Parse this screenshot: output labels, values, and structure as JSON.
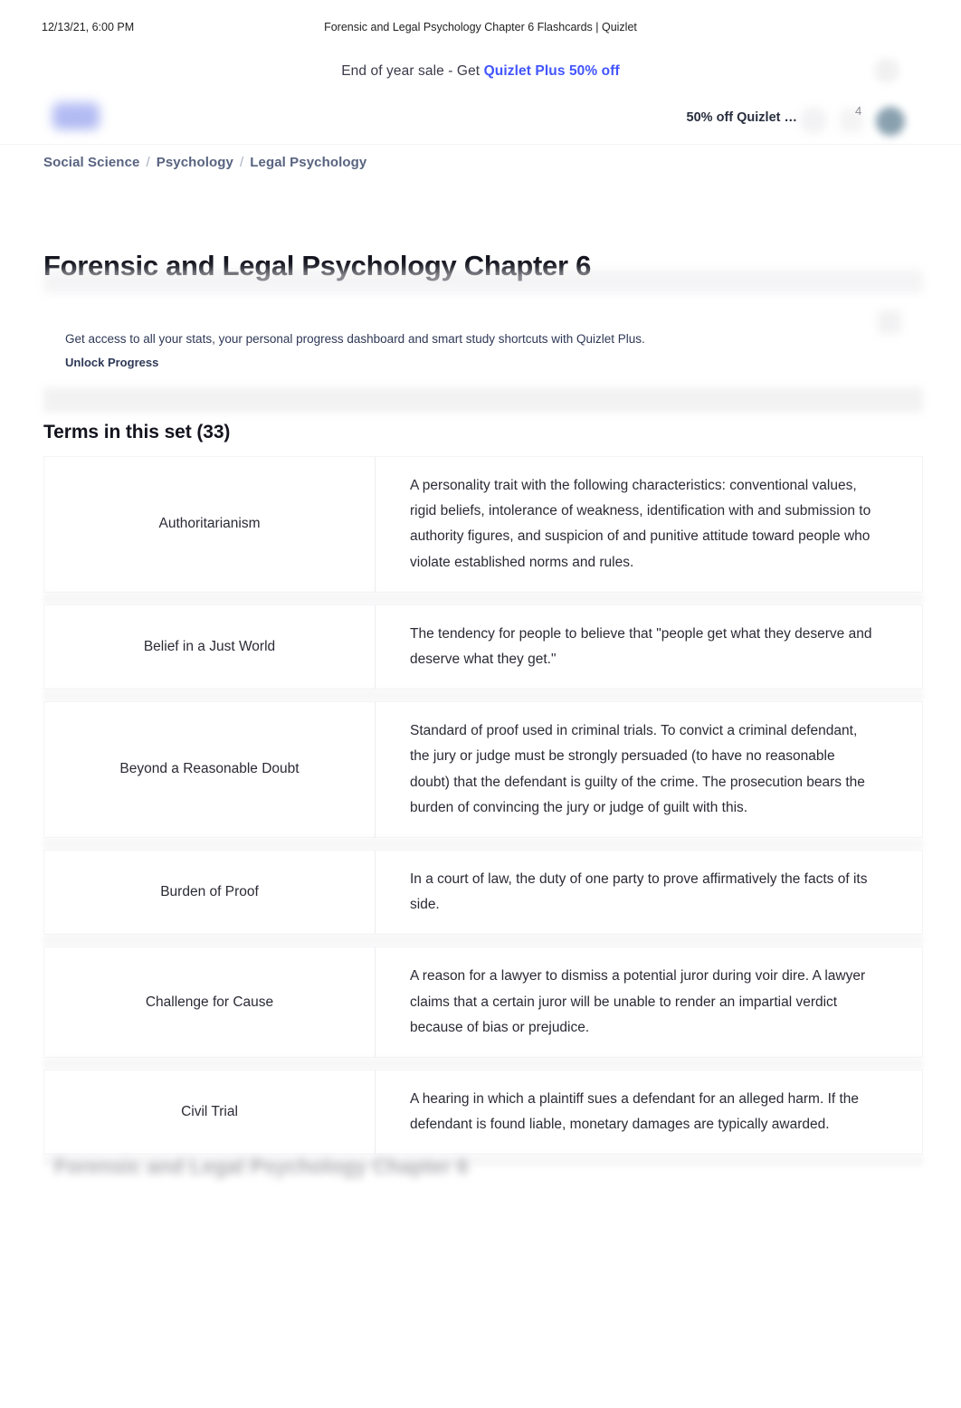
{
  "print_header": {
    "date": "12/13/21, 6:00 PM",
    "title": "Forensic and Legal Psychology Chapter 6 Flashcards | Quizlet"
  },
  "promo": {
    "prefix": "End of year sale - Get ",
    "link_label": "Quizlet Plus 50% off",
    "close_icon": "close-icon",
    "link_color": "#4255ff"
  },
  "navbar": {
    "logo": "quizlet-logo",
    "upsell_label": "50% off Quizlet …",
    "search_icon": "search-icon",
    "plus_icon": "plus-icon",
    "notification_count": "4",
    "avatar": "user-avatar"
  },
  "breadcrumb": {
    "items": [
      {
        "label": "Social Science"
      },
      {
        "label": "Psychology"
      },
      {
        "label": "Legal Psychology"
      }
    ],
    "separator": "/",
    "color": "#586380"
  },
  "set": {
    "title": "Forensic and Legal Psychology Chapter 6"
  },
  "progress": {
    "description": "Get access to all your stats, your personal progress dashboard and smart study shortcuts with Quizlet Plus.",
    "cta_label": "Unlock Progress",
    "icon": "chart-icon"
  },
  "terms_section": {
    "heading": "Terms in this set (33)",
    "count": 33,
    "items": [
      {
        "term": "Authoritarianism",
        "definition": "A personality trait with the following characteristics: conventional values, rigid beliefs, intolerance of weakness, identification with and submission to authority figures, and suspicion of and punitive attitude toward people who violate established norms and rules."
      },
      {
        "term": "Belief in a Just World",
        "definition": "The tendency for people to believe that \"people get what they deserve and deserve what they get.\""
      },
      {
        "term": "Beyond a Reasonable Doubt",
        "definition": "Standard of proof used in criminal trials. To convict a criminal defendant, the jury or judge must be strongly persuaded (to have no reasonable doubt) that the defendant is guilty of the crime. The prosecution bears the burden of convincing the jury or judge of guilt with this."
      },
      {
        "term": "Burden of Proof",
        "definition": "In a court of law, the duty of one party to prove affirmatively the facts of its side."
      },
      {
        "term": "Challenge for Cause",
        "definition": "A reason for a lawyer to dismiss a potential juror during voir dire. A lawyer claims that a certain juror will be unable to render an impartial verdict because of bias or prejudice."
      },
      {
        "term": "Civil Trial",
        "definition": "A hearing in which a plaintiff sues a defendant for an alleged harm. If the defendant is found liable, monetary damages are typically awarded."
      }
    ]
  },
  "footer": {
    "ghost_title": "Forensic and Legal Psychology Chapter 6"
  }
}
